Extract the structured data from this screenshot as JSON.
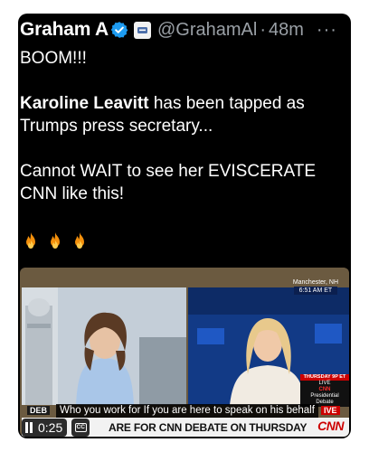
{
  "post": {
    "display_name": "Graham A",
    "handle": "@GrahamAl",
    "separator": "·",
    "time": "48m",
    "more": "···",
    "lines": {
      "l1": "BOOM!!!",
      "l2_bold": "Karoline Leavitt",
      "l2_rest": " has been tapped as",
      "l3": "Trumps press secretary...",
      "l4": "Cannot WAIT to see her EVISCERATE",
      "l5": "CNN like this!"
    },
    "emojis": [
      "fire-emoji",
      "fire-emoji",
      "fire-emoji"
    ]
  },
  "video": {
    "location": "Manchester, NH",
    "clock": "6:51 AM ET",
    "caption": "Who you work for If you are here to speak on his behalf",
    "deb_tag": "DEB",
    "live_tag": "IVE",
    "chyron": "ARE FOR CNN DEBATE ON THURSDAY",
    "network": "CNN",
    "graphic": {
      "header": "THURSDAY 9P ET",
      "live": "LIVE",
      "brand": "CNN",
      "line1": "Presidential",
      "line2": "Debate"
    },
    "player_time": "0:25",
    "cc_label": "CC"
  },
  "colors": {
    "background": "#000000",
    "verified_blue": "#1d9bf0",
    "cnn_red": "#cc0000"
  }
}
